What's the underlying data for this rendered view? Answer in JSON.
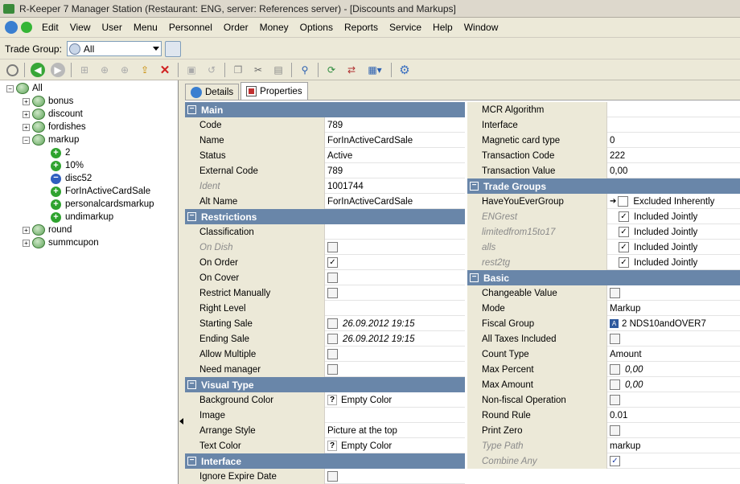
{
  "window": {
    "title": "R-Keeper 7 Manager Station (Restaurant: ENG, server: References server) - [Discounts and Markups]"
  },
  "menu": [
    "Edit",
    "View",
    "User",
    "Menu",
    "Personnel",
    "Order",
    "Money",
    "Options",
    "Reports",
    "Service",
    "Help",
    "Window"
  ],
  "trade_group": {
    "label": "Trade Group:",
    "value": "All"
  },
  "tree": {
    "root": "All",
    "items": [
      "bonus",
      "discount",
      "fordishes",
      "markup",
      "round",
      "summcupon"
    ],
    "markup_children": [
      "2",
      "10%",
      "disc52",
      "ForInActiveCardSale",
      "personalcardsmarkup",
      "undimarkup"
    ]
  },
  "tabs": {
    "details": "Details",
    "properties": "Properties"
  },
  "left": {
    "main": {
      "title": "Main",
      "rows": [
        [
          "Code",
          "789"
        ],
        [
          "Name",
          "ForInActiveCardSale"
        ],
        [
          "Status",
          "Active"
        ],
        [
          "External Code",
          "789"
        ],
        [
          "Ident",
          "1001744"
        ],
        [
          "Alt Name",
          "ForInActiveCardSale"
        ]
      ]
    },
    "restrictions": {
      "title": "Restrictions",
      "classification": "Classification",
      "on_dish": "On Dish",
      "on_order": "On Order",
      "on_cover": "On Cover",
      "restrict_manually": "Restrict Manually",
      "right_level": "Right Level",
      "starting_sale": "Starting Sale",
      "starting_sale_value": "26.09.2012 19:15",
      "ending_sale": "Ending Sale",
      "ending_sale_value": "26.09.2012 19:15",
      "allow_multiple": "Allow Multiple",
      "need_manager": "Need manager"
    },
    "visual": {
      "title": "Visual Type",
      "background_color": "Background Color",
      "background_color_value": "Empty Color",
      "image": "Image",
      "arrange_style": "Arrange Style",
      "arrange_style_value": "Picture at the top",
      "text_color": "Text Color",
      "text_color_value": "Empty Color"
    },
    "interface": {
      "title": "Interface",
      "ignore_expire_date": "Ignore Expire Date"
    }
  },
  "right": {
    "top_rows": [
      [
        "MCR Algorithm",
        ""
      ],
      [
        "Interface",
        ""
      ],
      [
        "Magnetic card type",
        "0"
      ],
      [
        "Transaction Code",
        "222"
      ],
      [
        "Transaction Value",
        "0,00"
      ]
    ],
    "trade_groups": {
      "title": "Trade Groups",
      "rows": [
        [
          "HaveYouEverGroup",
          "Excluded Inherently"
        ],
        [
          "ENGrest",
          "Included Jointly"
        ],
        [
          "limitedfrom15to17",
          "Included Jointly"
        ],
        [
          "alls",
          "Included Jointly"
        ],
        [
          "rest2tg",
          "Included Jointly"
        ]
      ]
    },
    "basic": {
      "title": "Basic",
      "changeable_value": "Changeable Value",
      "mode": "Mode",
      "mode_value": "Markup",
      "fiscal_group": "Fiscal Group",
      "fiscal_group_value": "2 NDS10andOVER7",
      "all_taxes": "All Taxes Included",
      "count_type": "Count Type",
      "count_type_value": "Amount",
      "max_percent": "Max Percent",
      "max_percent_value": "0,00",
      "max_amount": "Max Amount",
      "max_amount_value": "0,00",
      "nonfiscal": "Non-fiscal Operation",
      "round_rule": "Round Rule",
      "round_rule_value": "0.01",
      "print_zero": "Print Zero",
      "type_path": "Type Path",
      "type_path_value": "markup",
      "combine_any": "Combine Any"
    }
  }
}
